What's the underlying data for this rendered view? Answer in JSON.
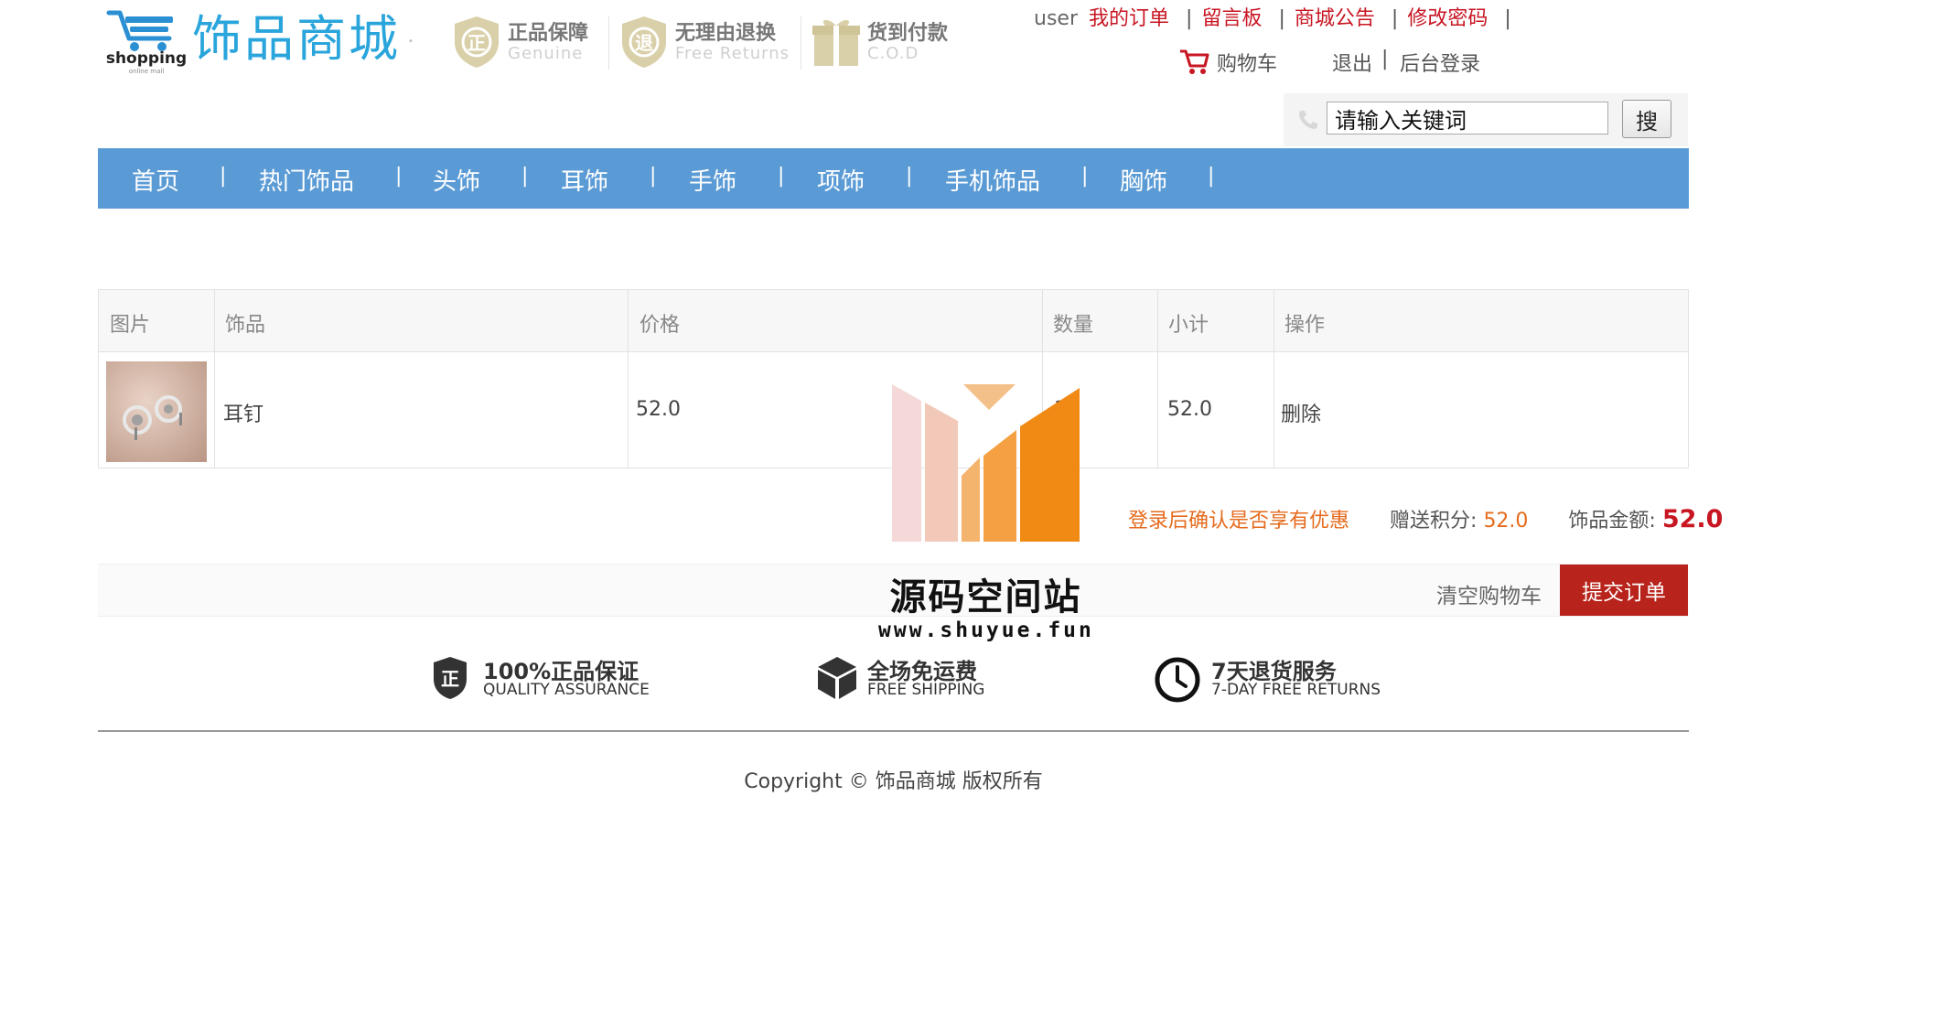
{
  "brand": {
    "logo_text": "shopping",
    "logo_subtext": "online mall",
    "site_name": "饰品商城"
  },
  "badges": [
    {
      "title": "正品保障",
      "subtitle": "Genuine",
      "icon": "shield-zheng-icon"
    },
    {
      "title": "无理由退换",
      "subtitle": "Free Returns",
      "icon": "shield-tui-icon"
    },
    {
      "title": "货到付款",
      "subtitle": "C.O.D",
      "icon": "gift-box-icon"
    }
  ],
  "topnav": {
    "username": "user",
    "links": [
      "我的订单",
      "留言板",
      "商城公告",
      "修改密码"
    ],
    "separator": "|"
  },
  "account": {
    "cart_label": "购物车",
    "logout": "退出",
    "separator": "|",
    "admin_login": "后台登录"
  },
  "search": {
    "value": "请输入关键词",
    "button": "搜"
  },
  "mainnav": {
    "items": [
      "首页",
      "热门饰品",
      "头饰",
      "耳饰",
      "手饰",
      "项饰",
      "手机饰品",
      "胸饰"
    ],
    "separator": "|"
  },
  "cart": {
    "columns": [
      "图片",
      "饰品",
      "价格",
      "数量",
      "小计",
      "操作"
    ],
    "rows": [
      {
        "name": "耳钉",
        "price": "52.0",
        "quantity": "1",
        "subtotal": "52.0",
        "action": "删除"
      }
    ]
  },
  "summary": {
    "promo_note": "登录后确认是否享有优惠",
    "points_label": "赠送积分:",
    "points_value": "52.0",
    "amount_label": "饰品金额:",
    "amount_value": "52.0"
  },
  "actions": {
    "clear_cart": "清空购物车",
    "submit_order": "提交订单"
  },
  "services": [
    {
      "title": "100%正品保证",
      "subtitle": "QUALITY ASSURANCE",
      "icon": "shield-quality-icon"
    },
    {
      "title": "全场免运费",
      "subtitle": "FREE SHIPPING",
      "icon": "package-box-icon"
    },
    {
      "title": "7天退货服务",
      "subtitle": "7-DAY FREE RETURNS",
      "icon": "clock-icon"
    }
  ],
  "footer": {
    "copyright": "Copyright © 饰品商城 版权所有"
  },
  "watermark": {
    "title": "源码空间站",
    "url": "www.shuyue.fun"
  },
  "colors": {
    "brand_blue": "#2aa5dc",
    "nav_blue": "#5b9bd5",
    "link_red": "#c81623",
    "submit_red": "#b8231b",
    "promo_orange": "#e56b1d"
  }
}
